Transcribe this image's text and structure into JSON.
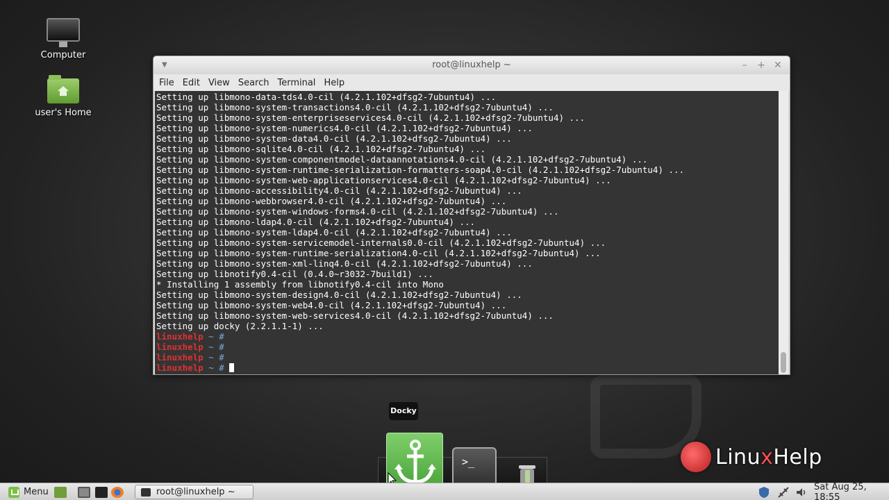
{
  "desktop": {
    "icons": [
      {
        "label": "Computer"
      },
      {
        "label": "user's Home"
      }
    ],
    "watermark": {
      "brand_prefix": "Linu",
      "brand_accent": "x",
      "brand_suffix": "Help"
    }
  },
  "terminal": {
    "title": "root@linuxhelp ~",
    "menu": [
      "File",
      "Edit",
      "View",
      "Search",
      "Terminal",
      "Help"
    ],
    "output_lines": [
      "Setting up libmono-data-tds4.0-cil (4.2.1.102+dfsg2-7ubuntu4) ...",
      "Setting up libmono-system-transactions4.0-cil (4.2.1.102+dfsg2-7ubuntu4) ...",
      "Setting up libmono-system-enterpriseservices4.0-cil (4.2.1.102+dfsg2-7ubuntu4) ...",
      "Setting up libmono-system-numerics4.0-cil (4.2.1.102+dfsg2-7ubuntu4) ...",
      "Setting up libmono-system-data4.0-cil (4.2.1.102+dfsg2-7ubuntu4) ...",
      "Setting up libmono-sqlite4.0-cil (4.2.1.102+dfsg2-7ubuntu4) ...",
      "Setting up libmono-system-componentmodel-dataannotations4.0-cil (4.2.1.102+dfsg2-7ubuntu4) ...",
      "Setting up libmono-system-runtime-serialization-formatters-soap4.0-cil (4.2.1.102+dfsg2-7ubuntu4) ...",
      "Setting up libmono-system-web-applicationservices4.0-cil (4.2.1.102+dfsg2-7ubuntu4) ...",
      "Setting up libmono-accessibility4.0-cil (4.2.1.102+dfsg2-7ubuntu4) ...",
      "Setting up libmono-webbrowser4.0-cil (4.2.1.102+dfsg2-7ubuntu4) ...",
      "Setting up libmono-system-windows-forms4.0-cil (4.2.1.102+dfsg2-7ubuntu4) ...",
      "Setting up libmono-ldap4.0-cil (4.2.1.102+dfsg2-7ubuntu4) ...",
      "Setting up libmono-system-ldap4.0-cil (4.2.1.102+dfsg2-7ubuntu4) ...",
      "Setting up libmono-system-servicemodel-internals0.0-cil (4.2.1.102+dfsg2-7ubuntu4) ...",
      "Setting up libmono-system-runtime-serialization4.0-cil (4.2.1.102+dfsg2-7ubuntu4) ...",
      "Setting up libmono-system-xml-linq4.0-cil (4.2.1.102+dfsg2-7ubuntu4) ...",
      "Setting up libnotify0.4-cil (0.4.0~r3032-7build1) ...",
      "* Installing 1 assembly from libnotify0.4-cil into Mono",
      "Setting up libmono-system-design4.0-cil (4.2.1.102+dfsg2-7ubuntu4) ...",
      "Setting up libmono-system-web4.0-cil (4.2.1.102+dfsg2-7ubuntu4) ...",
      "Setting up libmono-system-web-services4.0-cil (4.2.1.102+dfsg2-7ubuntu4) ...",
      "Setting up docky (2.2.1.1-1) ..."
    ],
    "prompt_user": "linuxhelp",
    "prompt_rest": " ~ # ",
    "prompt_count": 4
  },
  "dock": {
    "tooltip": "Docky"
  },
  "taskbar": {
    "menu_label": "Menu",
    "task_label": "root@linuxhelp ~",
    "clock": "Sat Aug 25, 18:55"
  }
}
